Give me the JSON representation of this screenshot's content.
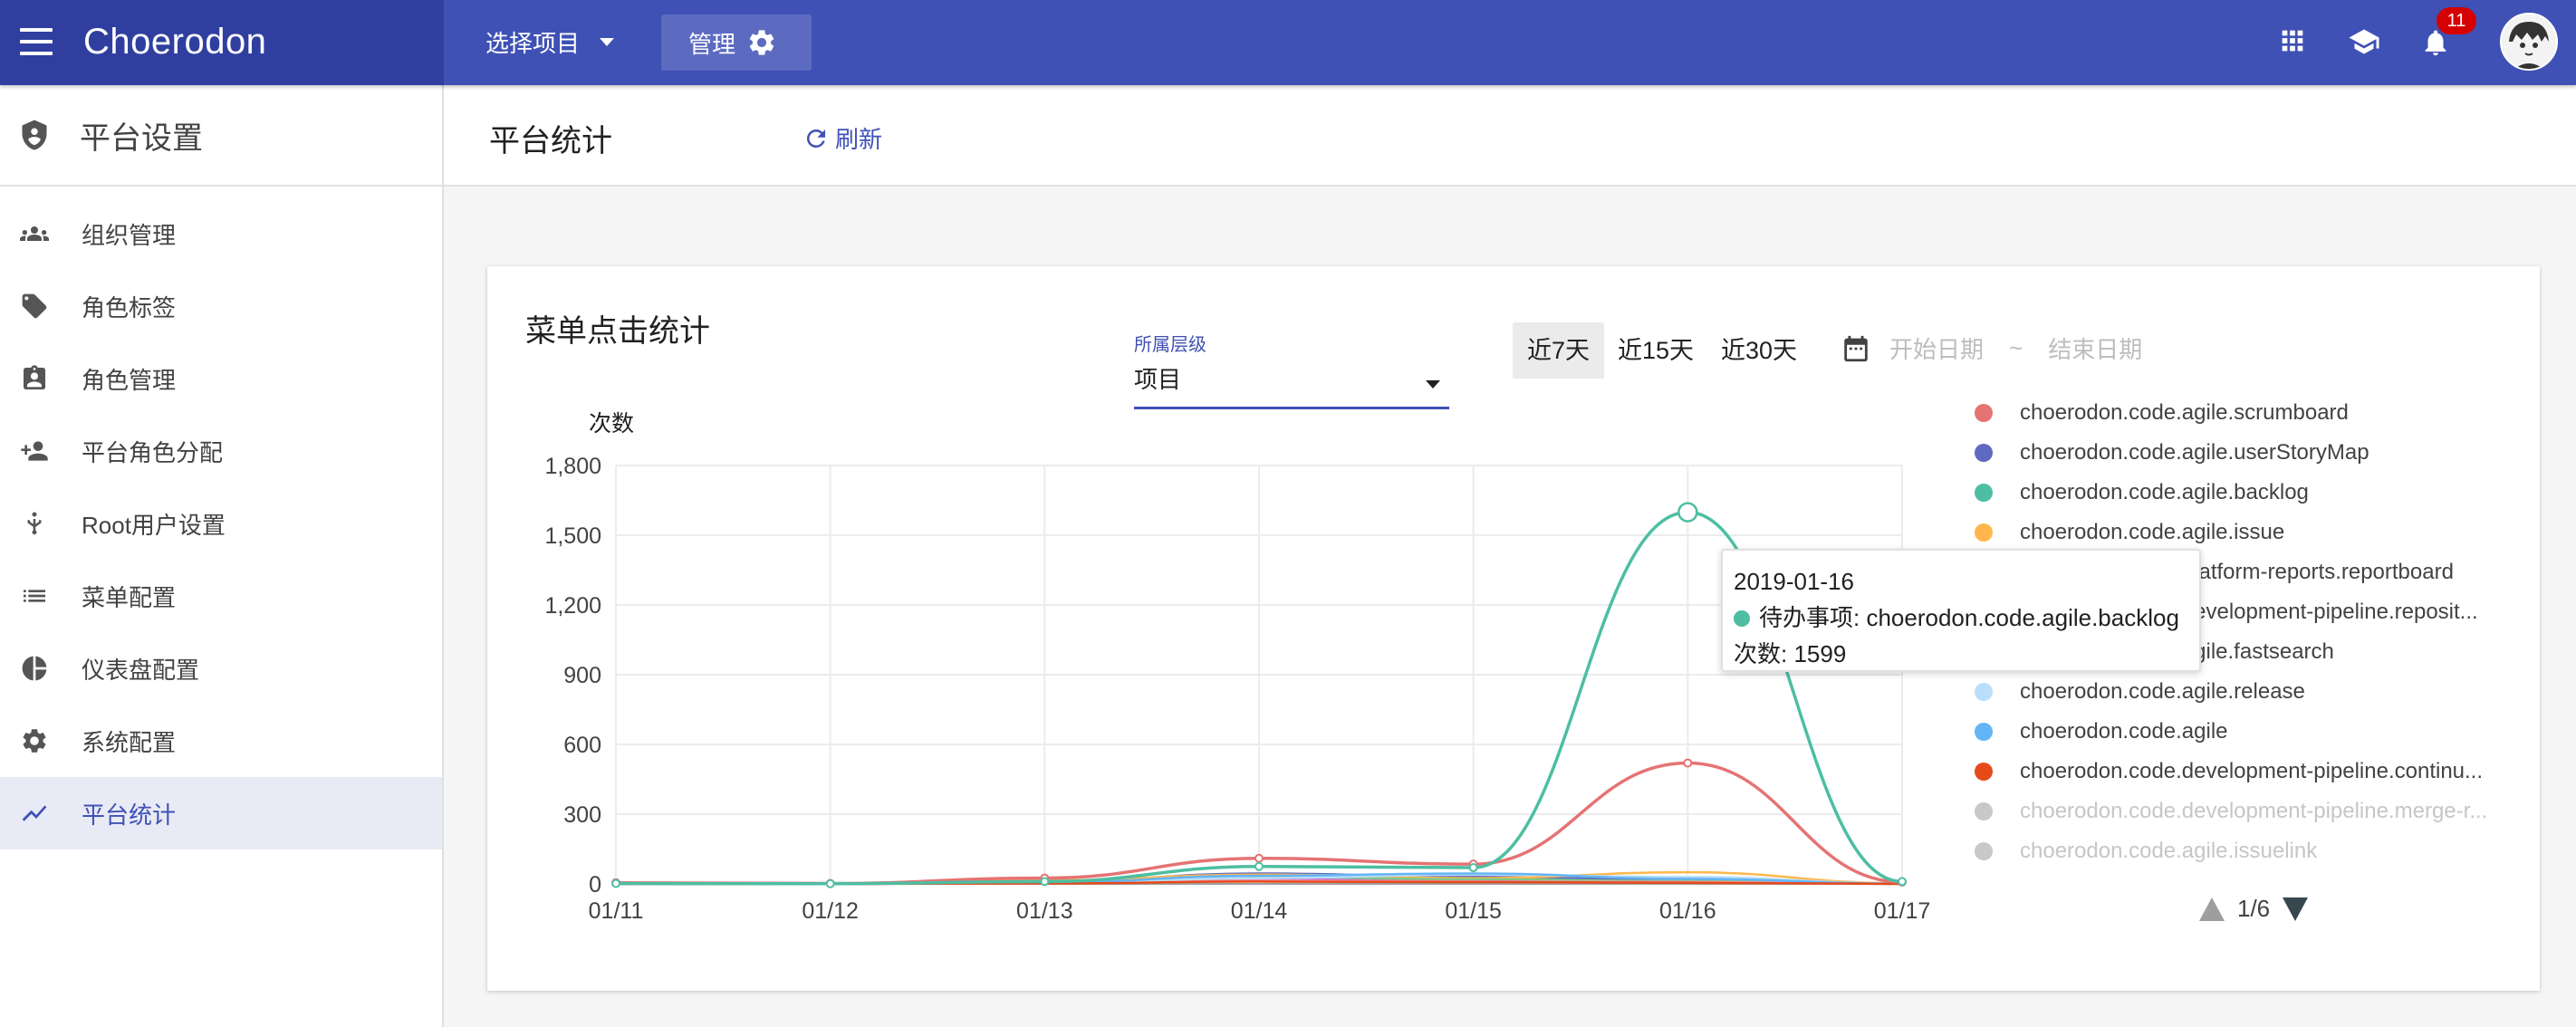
{
  "topbar": {
    "brand": "Choerodon",
    "project_select": "选择项目",
    "manage_label": "管理",
    "notifications_count": "11",
    "colors": {
      "bar": "#3f51b5",
      "brand_bg": "#303f9f"
    }
  },
  "sidebar": {
    "header": "平台设置",
    "items": [
      {
        "label": "组织管理",
        "icon": "group-icon",
        "active": false
      },
      {
        "label": "角色标签",
        "icon": "role-tag-icon",
        "active": false
      },
      {
        "label": "角色管理",
        "icon": "role-badge-icon",
        "active": false
      },
      {
        "label": "平台角色分配",
        "icon": "person-add-icon",
        "active": false
      },
      {
        "label": "Root用户设置",
        "icon": "root-user-icon",
        "active": false
      },
      {
        "label": "菜单配置",
        "icon": "list-icon",
        "active": false
      },
      {
        "label": "仪表盘配置",
        "icon": "pie-icon",
        "active": false
      },
      {
        "label": "系统配置",
        "icon": "gear-icon",
        "active": false
      },
      {
        "label": "平台统计",
        "icon": "trend-icon",
        "active": true
      }
    ]
  },
  "page": {
    "title": "平台统计",
    "refresh_label": "刷新"
  },
  "card": {
    "title": "菜单点击统计",
    "level_label": "所属层级",
    "level_value": "项目",
    "ranges": [
      {
        "label": "近7天",
        "selected": true
      },
      {
        "label": "近15天",
        "selected": false
      },
      {
        "label": "近30天",
        "selected": false
      }
    ],
    "start_placeholder": "开始日期",
    "date_sep": "~",
    "end_placeholder": "结束日期"
  },
  "tooltip": {
    "date": "2019-01-16",
    "series_line": "待办事项: choerodon.code.agile.backlog",
    "count_line": "次数: 1599",
    "color": "#4dbea2"
  },
  "legend": {
    "page": "1/6"
  },
  "chart_data": {
    "type": "line",
    "ylabel": "次数",
    "ylim": [
      0,
      1800
    ],
    "yticks": [
      "0",
      "300",
      "600",
      "900",
      "1,200",
      "1,500",
      "1,800"
    ],
    "categories": [
      "01/11",
      "01/12",
      "01/13",
      "01/14",
      "01/15",
      "01/16",
      "01/17"
    ],
    "series": [
      {
        "name": "choerodon.code.agile.scrumboard",
        "color": "#e57373",
        "values": [
          5,
          2,
          25,
          110,
          85,
          520,
          8
        ]
      },
      {
        "name": "choerodon.code.agile.userStoryMap",
        "color": "#5c6bc0",
        "values": [
          0,
          0,
          8,
          45,
          30,
          18,
          2
        ]
      },
      {
        "name": "choerodon.code.agile.backlog",
        "color": "#4dbea2",
        "values": [
          2,
          1,
          10,
          75,
          70,
          1599,
          10
        ]
      },
      {
        "name": "choerodon.code.agile.issue",
        "color": "#ffb74d",
        "values": [
          0,
          0,
          15,
          40,
          25,
          50,
          3
        ]
      },
      {
        "name": "choerodon.code.platform-reports.reportboard",
        "color": "#ba68c8",
        "values": [
          0,
          0,
          3,
          20,
          12,
          10,
          1
        ]
      },
      {
        "name": "choerodon.code.development-pipeline.reposit...",
        "color": "#81c784",
        "values": [
          0,
          0,
          5,
          30,
          20,
          12,
          1
        ]
      },
      {
        "name": "choerodon.code.agile.fastsearch",
        "color": "#f48fb1",
        "values": [
          0,
          0,
          2,
          15,
          10,
          8,
          0
        ]
      },
      {
        "name": "choerodon.code.agile.release",
        "color": "#bbdefb",
        "values": [
          0,
          0,
          3,
          25,
          40,
          30,
          2
        ]
      },
      {
        "name": "choerodon.code.agile",
        "color": "#64b5f6",
        "values": [
          0,
          0,
          6,
          35,
          45,
          22,
          1
        ]
      },
      {
        "name": "choerodon.code.development-pipeline.continu...",
        "color": "#e64a19",
        "values": [
          0,
          0,
          2,
          10,
          8,
          5,
          0
        ]
      },
      {
        "name": "choerodon.code.development-pipeline.merge-r...",
        "color": "#c8c8c8",
        "values": [
          0,
          0,
          0,
          0,
          0,
          0,
          0
        ],
        "disabled": true
      },
      {
        "name": "choerodon.code.agile.issuelink",
        "color": "#c8c8c8",
        "values": [
          0,
          0,
          0,
          0,
          0,
          0,
          0
        ],
        "disabled": true
      }
    ]
  }
}
